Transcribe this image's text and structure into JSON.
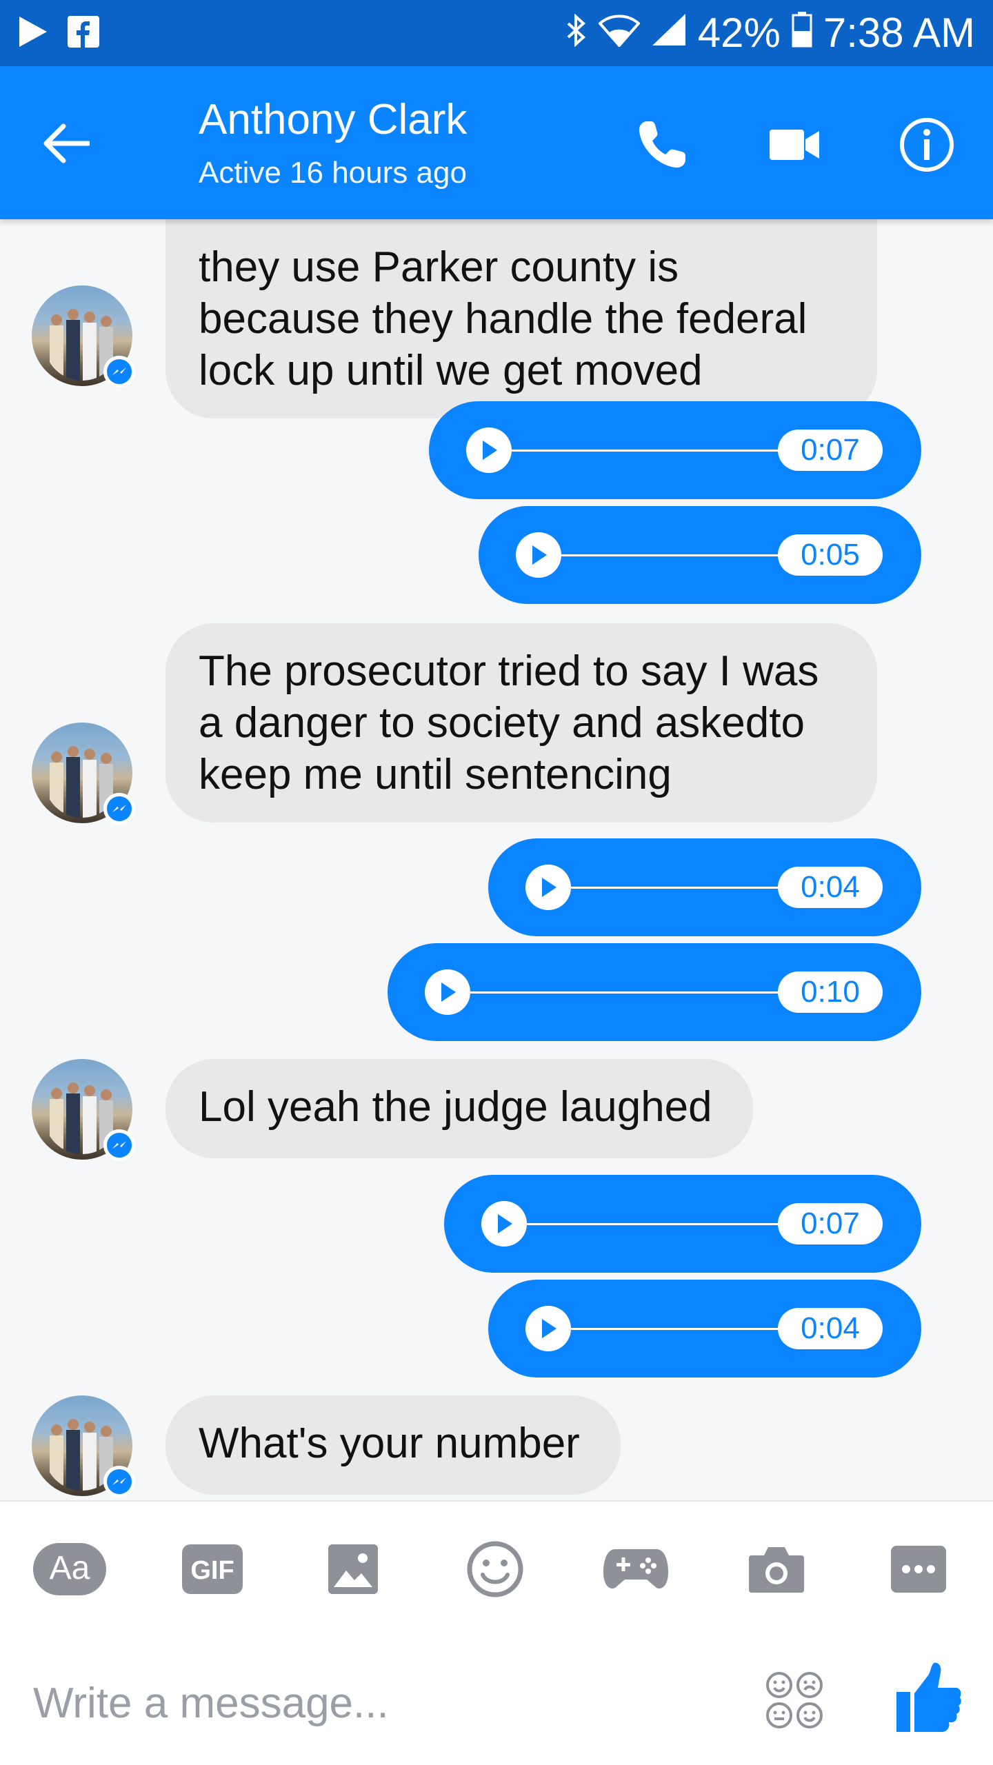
{
  "status_bar": {
    "battery": "42%",
    "time": "7:38 AM"
  },
  "header": {
    "name": "Anthony Clark",
    "status": "Active 16 hours ago"
  },
  "messages": [
    {
      "type": "text-in",
      "lines": [
        "they use Parker county is",
        "because they handle the federal",
        "lock up until we get moved"
      ]
    },
    {
      "type": "audio-out",
      "duration": "0:07"
    },
    {
      "type": "audio-out",
      "duration": "0:05"
    },
    {
      "type": "text-in",
      "lines": [
        "The prosecutor tried to say I was",
        "a danger to society and askedto",
        "keep me until sentencing"
      ]
    },
    {
      "type": "audio-out",
      "duration": "0:04"
    },
    {
      "type": "audio-out",
      "duration": "0:10"
    },
    {
      "type": "text-in",
      "lines": [
        "Lol yeah the judge laughed"
      ]
    },
    {
      "type": "audio-out",
      "duration": "0:07"
    },
    {
      "type": "audio-out",
      "duration": "0:04"
    },
    {
      "type": "text-in",
      "lines": [
        "What's your number"
      ]
    }
  ],
  "composer": {
    "text_tool_label": "Aa",
    "gif_label": "GIF",
    "placeholder": "Write a message..."
  },
  "colors": {
    "status_bar": "#0b63c8",
    "header": "#0a84ff",
    "bubble_out": "#0a84ff",
    "bubble_in": "#e8e8ea",
    "toolbar_icons": "#8e9197"
  }
}
